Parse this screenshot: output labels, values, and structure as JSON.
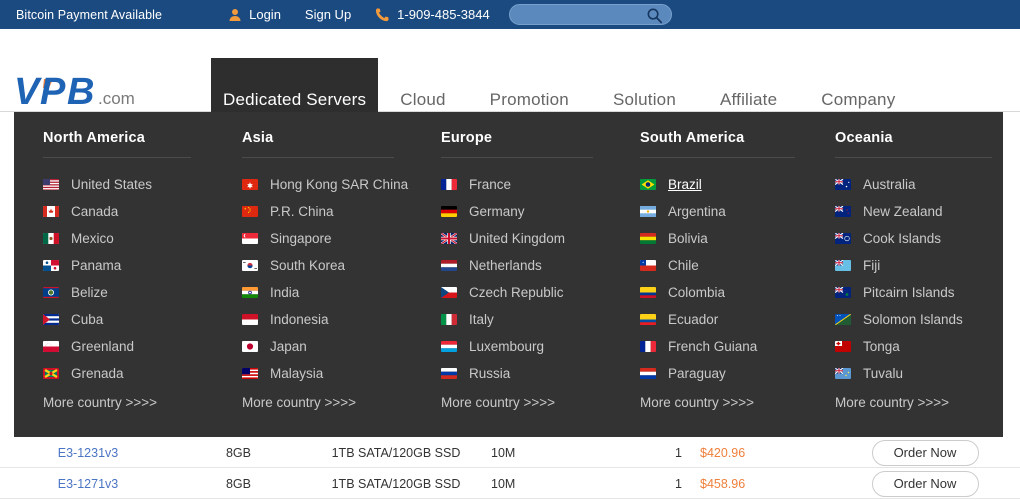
{
  "topbar": {
    "promo": "Bitcoin Payment Available",
    "login": "Login",
    "signup": "Sign Up",
    "phone": "1-909-485-3844",
    "search_placeholder": "",
    "search_value": "",
    "user_icon": "user-icon",
    "phone_icon": "phone-icon",
    "search_icon": "search-icon",
    "bg_color": "#1b4a80",
    "accent_color": "#f29a3c"
  },
  "logo": {
    "text": "VPB",
    "suffix": ".com",
    "primary_color": "#1f63b5",
    "accent_color": "#f0803c",
    "suffix_color": "#7a7a7a"
  },
  "nav": {
    "items": [
      {
        "label": "Dedicated Servers",
        "active": true
      },
      {
        "label": "Cloud",
        "active": false
      },
      {
        "label": "Promotion",
        "active": false
      },
      {
        "label": "Solution",
        "active": false
      },
      {
        "label": "Affiliate",
        "active": false
      },
      {
        "label": "Company",
        "active": false
      }
    ],
    "active_bg": "#2e2e2e"
  },
  "dropdown": {
    "bg_color": "#333333",
    "more_label": "More country >>>>",
    "columns": [
      {
        "title": "North America",
        "items": [
          {
            "label": "United States",
            "flag": "flag-us",
            "hover": false
          },
          {
            "label": "Canada",
            "flag": "flag-ca",
            "hover": false
          },
          {
            "label": "Mexico",
            "flag": "flag-mx",
            "hover": false
          },
          {
            "label": "Panama",
            "flag": "flag-pa",
            "hover": false
          },
          {
            "label": "Belize",
            "flag": "flag-bz",
            "hover": false
          },
          {
            "label": "Cuba",
            "flag": "flag-cu",
            "hover": false
          },
          {
            "label": "Greenland",
            "flag": "flag-gl",
            "hover": false
          },
          {
            "label": "Grenada",
            "flag": "flag-gd",
            "hover": false
          }
        ]
      },
      {
        "title": "Asia",
        "items": [
          {
            "label": "Hong Kong SAR China",
            "flag": "flag-hk",
            "hover": false
          },
          {
            "label": "P.R. China",
            "flag": "flag-cn",
            "hover": false
          },
          {
            "label": "Singapore",
            "flag": "flag-sg",
            "hover": false
          },
          {
            "label": "South Korea",
            "flag": "flag-kr",
            "hover": false
          },
          {
            "label": "India",
            "flag": "flag-in",
            "hover": false
          },
          {
            "label": "Indonesia",
            "flag": "flag-id",
            "hover": false
          },
          {
            "label": "Japan",
            "flag": "flag-jp",
            "hover": false
          },
          {
            "label": "Malaysia",
            "flag": "flag-my",
            "hover": false
          }
        ]
      },
      {
        "title": "Europe",
        "items": [
          {
            "label": "France",
            "flag": "flag-fr",
            "hover": false
          },
          {
            "label": "Germany",
            "flag": "flag-de",
            "hover": false
          },
          {
            "label": "United Kingdom",
            "flag": "flag-gb",
            "hover": false
          },
          {
            "label": "Netherlands",
            "flag": "flag-nl",
            "hover": false
          },
          {
            "label": "Czech Republic",
            "flag": "flag-cz",
            "hover": false
          },
          {
            "label": "Italy",
            "flag": "flag-it",
            "hover": false
          },
          {
            "label": "Luxembourg",
            "flag": "flag-lu",
            "hover": false
          },
          {
            "label": "Russia",
            "flag": "flag-ru",
            "hover": false
          }
        ]
      },
      {
        "title": "South America",
        "items": [
          {
            "label": "Brazil",
            "flag": "flag-br",
            "hover": true
          },
          {
            "label": "Argentina",
            "flag": "flag-ar",
            "hover": false
          },
          {
            "label": "Bolivia",
            "flag": "flag-bo",
            "hover": false
          },
          {
            "label": "Chile",
            "flag": "flag-cl",
            "hover": false
          },
          {
            "label": "Colombia",
            "flag": "flag-co",
            "hover": false
          },
          {
            "label": "Ecuador",
            "flag": "flag-ec",
            "hover": false
          },
          {
            "label": "French Guiana",
            "flag": "flag-gf",
            "hover": false
          },
          {
            "label": "Paraguay",
            "flag": "flag-py",
            "hover": false
          }
        ]
      },
      {
        "title": "Oceania",
        "items": [
          {
            "label": "Australia",
            "flag": "flag-au",
            "hover": false
          },
          {
            "label": "New Zealand",
            "flag": "flag-nz",
            "hover": false
          },
          {
            "label": "Cook Islands",
            "flag": "flag-ck",
            "hover": false
          },
          {
            "label": "Fiji",
            "flag": "flag-fj",
            "hover": false
          },
          {
            "label": "Pitcairn Islands",
            "flag": "flag-pn",
            "hover": false
          },
          {
            "label": "Solomon Islands",
            "flag": "flag-sb",
            "hover": false
          },
          {
            "label": "Tonga",
            "flag": "flag-to",
            "hover": false
          },
          {
            "label": "Tuvalu",
            "flag": "flag-tv",
            "hover": false
          }
        ]
      }
    ]
  },
  "table": {
    "order_label": "Order Now",
    "price_color": "#ef7f3b",
    "cpu_color": "#4a74c4",
    "rows": [
      {
        "cpu": "E3-1231v3",
        "ram": "8GB",
        "disk": "1TB SATA/120GB SSD",
        "bandwidth": "10M",
        "ip": "1",
        "price": "$420.96"
      },
      {
        "cpu": "E3-1271v3",
        "ram": "8GB",
        "disk": "1TB SATA/120GB SSD",
        "bandwidth": "10M",
        "ip": "1",
        "price": "$458.96"
      }
    ]
  }
}
